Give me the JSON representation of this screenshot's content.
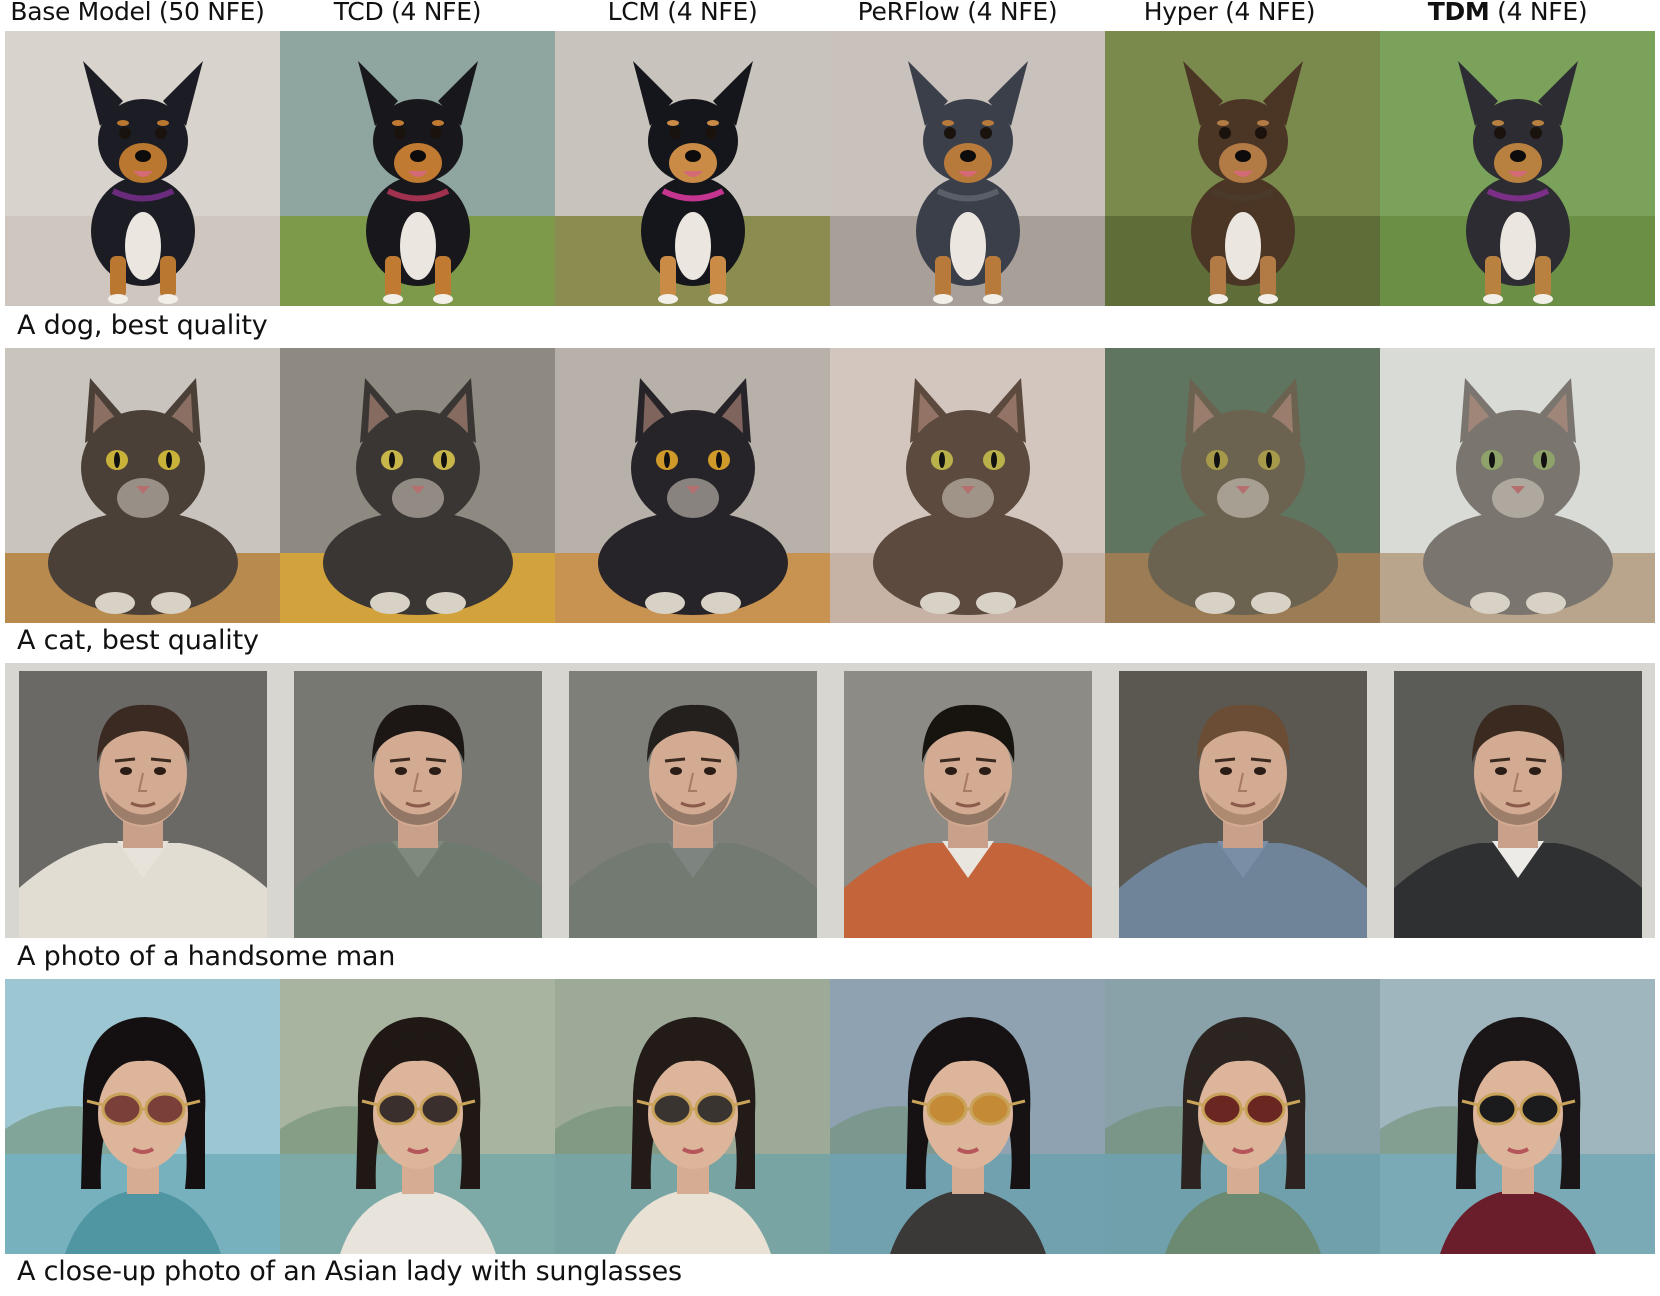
{
  "columns": [
    {
      "label": "Base Model (50 NFE)",
      "bold_part": ""
    },
    {
      "label": "TCD (4 NFE)",
      "bold_part": ""
    },
    {
      "label": "LCM (4 NFE)",
      "bold_part": ""
    },
    {
      "label": "PeRFlow (4 NFE)",
      "bold_part": ""
    },
    {
      "label": "Hyper (4 NFE)",
      "bold_part": ""
    },
    {
      "label": " (4 NFE)",
      "bold_part": "TDM"
    }
  ],
  "rows": [
    {
      "caption": "A dog, best quality",
      "subject": "dog",
      "tiles": [
        {
          "bg": "#d9d3cd",
          "ground": "#cfc7bf",
          "fur": "#1c1d24",
          "accent": "#b9772f",
          "collar": "#6a2b7d"
        },
        {
          "bg": "#8ea5a0",
          "ground": "#7d9a4a",
          "fur": "#17171c",
          "accent": "#c07a32",
          "collar": "#a0314f"
        },
        {
          "bg": "#c8c4bd",
          "ground": "#8a8d4f",
          "fur": "#15161b",
          "accent": "#c98b46",
          "collar": "#c3358e"
        },
        {
          "bg": "#c9c2bc",
          "ground": "#a79f98",
          "fur": "#3b3f4a",
          "accent": "#b87a3b",
          "collar": "#5a5e66"
        },
        {
          "bg": "#7a8a4d",
          "ground": "#5f6d39",
          "fur": "#4b3626",
          "accent": "#b27a44",
          "collar": "#4a3a2a"
        },
        {
          "bg": "#7aa25a",
          "ground": "#6b8f45",
          "fur": "#2d2c33",
          "accent": "#b8813f",
          "collar": "#7b2f86"
        }
      ]
    },
    {
      "caption": "A cat, best quality",
      "subject": "cat",
      "tiles": [
        {
          "bg": "#c9c5be",
          "ground": "#b98a4e",
          "fur": "#4a4038",
          "accent": "#c8b23a",
          "collar": ""
        },
        {
          "bg": "#8e8a82",
          "ground": "#d2a23c",
          "fur": "#3a3633",
          "accent": "#c9b64b",
          "collar": ""
        },
        {
          "bg": "#b7b1aa",
          "ground": "#c89350",
          "fur": "#262428",
          "accent": "#d09a2a",
          "collar": ""
        },
        {
          "bg": "#d3c6bf",
          "ground": "#c7b2a6",
          "fur": "#5b4a3d",
          "accent": "#b9b24a",
          "collar": ""
        },
        {
          "bg": "#5f7560",
          "ground": "#9c7c54",
          "fur": "#6b6250",
          "accent": "#a69a4a",
          "collar": ""
        },
        {
          "bg": "#d8dbd6",
          "ground": "#b9a58c",
          "fur": "#7a756e",
          "accent": "#8ea26a",
          "collar": ""
        }
      ]
    },
    {
      "caption": "A photo of a handsome man",
      "subject": "man",
      "tiles": [
        {
          "bg": "#6b6965",
          "ground": "#e2ddd3",
          "fur": "#3a2a22",
          "accent": "#e7e3da",
          "collar": ""
        },
        {
          "bg": "#777872",
          "ground": "#6f7a6e",
          "fur": "#1c1614",
          "accent": "#7f8a7c",
          "collar": ""
        },
        {
          "bg": "#7e7f78",
          "ground": "#727a72",
          "fur": "#24201e",
          "accent": "#7e8580",
          "collar": ""
        },
        {
          "bg": "#8c8b86",
          "ground": "#c4643a",
          "fur": "#17130f",
          "accent": "#e9e6df",
          "collar": ""
        },
        {
          "bg": "#5a5850",
          "ground": "#6f8499",
          "fur": "#6a4d34",
          "accent": "#7a8fa5",
          "collar": ""
        },
        {
          "bg": "#5b5b58",
          "ground": "#2f3032",
          "fur": "#3a2a20",
          "accent": "#ecebe7",
          "collar": ""
        }
      ]
    },
    {
      "caption": "A close-up photo of an Asian lady with sunglasses",
      "subject": "lady",
      "tiles": [
        {
          "bg": "#9dc6d3",
          "ground": "#4f95a2",
          "fur": "#141011",
          "accent": "#7a3f38",
          "collar": ""
        },
        {
          "bg": "#a8b4a0",
          "ground": "#e8e4dc",
          "fur": "#1f1815",
          "accent": "#3a2f2d",
          "collar": ""
        },
        {
          "bg": "#9eaa98",
          "ground": "#e9e1d4",
          "fur": "#231b17",
          "accent": "#3a3431",
          "collar": ""
        },
        {
          "bg": "#8ea2b2",
          "ground": "#3b3937",
          "fur": "#161213",
          "accent": "#c48a36",
          "collar": ""
        },
        {
          "bg": "#89a1a9",
          "ground": "#6c8a72",
          "fur": "#2b2420",
          "accent": "#6a2620",
          "collar": ""
        },
        {
          "bg": "#9fb6bf",
          "ground": "#6a1d2a",
          "fur": "#1a1517",
          "accent": "#1b1b1d",
          "collar": ""
        }
      ]
    }
  ]
}
